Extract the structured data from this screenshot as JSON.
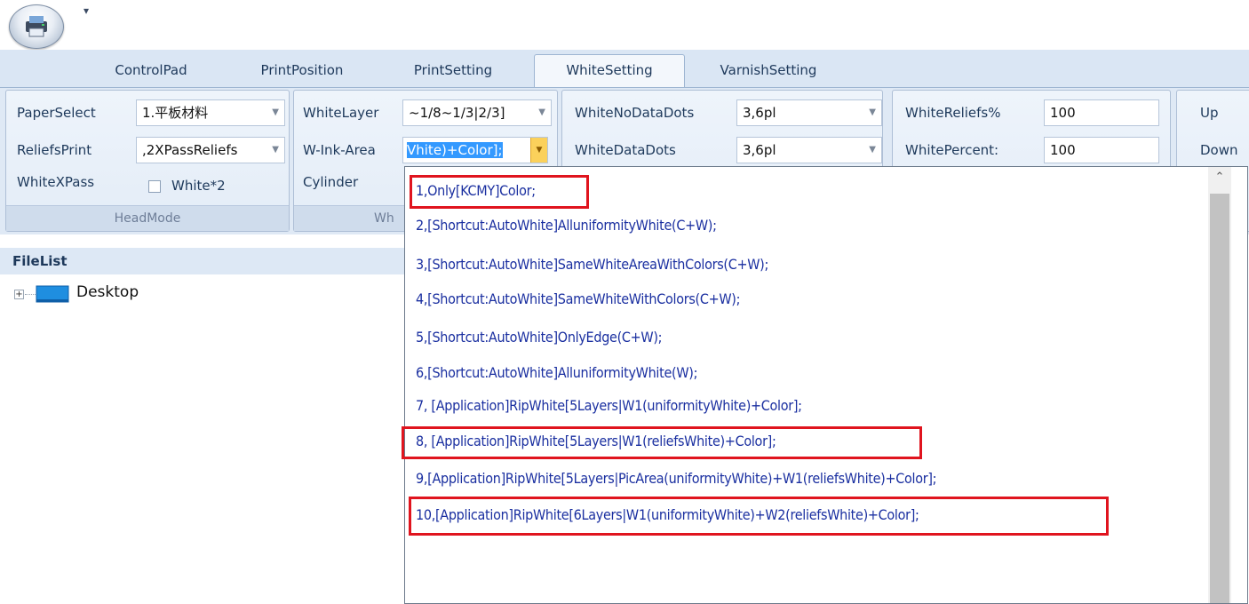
{
  "quick_access": {
    "dropdown_glyph": "▾"
  },
  "tabs": [
    {
      "label": "ControlPad"
    },
    {
      "label": "PrintPosition"
    },
    {
      "label": "PrintSetting"
    },
    {
      "label": "WhiteSetting",
      "active": true
    },
    {
      "label": "VarnishSetting"
    }
  ],
  "head_mode_group": {
    "caption": "HeadMode",
    "paper_select_label": "PaperSelect",
    "paper_select_value": "1.平板材料",
    "reliefs_print_label": "ReliefsPrint",
    "reliefs_print_value": ",2XPassReliefs",
    "white_xpass_label": "WhiteXPass",
    "white_x2_label": "White*2",
    "white_x2_checked": false
  },
  "white_group": {
    "caption_partial": "Wh",
    "white_layer_label": "WhiteLayer",
    "white_layer_value": "~1/8~1/3|2/3]",
    "w_ink_area_label": "W-Ink-Area",
    "w_ink_area_value": "Vhite)+Color];",
    "cylinder_label": "Cylinder"
  },
  "dots_group": {
    "white_no_data_dots_label": "WhiteNoDataDots",
    "white_no_data_dots_value": "3,6pl",
    "white_data_dots_label": "WhiteDataDots",
    "white_data_dots_value": "3,6pl"
  },
  "percent_group": {
    "white_reliefs_label": "WhiteReliefs%",
    "white_reliefs_value": "100",
    "white_percent_label": "WhitePercent:",
    "white_percent_value": "100"
  },
  "updown_group": {
    "up_label": "Up",
    "down_label": "Down"
  },
  "filelist": {
    "header": "FileList",
    "expander": "+",
    "root_item": "Desktop"
  },
  "dropdown": {
    "options": [
      "1,Only[KCMY]Color;",
      "2,[Shortcut:AutoWhite]AlluniformityWhite(C+W);",
      "3,[Shortcut:AutoWhite]SameWhiteAreaWithColors(C+W);",
      "4,[Shortcut:AutoWhite]SameWhiteWithColors(C+W);",
      "5,[Shortcut:AutoWhite]OnlyEdge(C+W);",
      "6,[Shortcut:AutoWhite]AlluniformityWhite(W);",
      "7, [Application]RipWhite[5Layers|W1(uniformityWhite)+Color];",
      "8, [Application]RipWhite[5Layers|W1(reliefsWhite)+Color];",
      "9,[Application]RipWhite[5Layers|PicArea(uniformityWhite)+W1(reliefsWhite)+Color];",
      "10,[Application]RipWhite[6Layers|W1(uniformityWhite)+W2(reliefsWhite)+Color];"
    ],
    "highlighted_options": [
      1,
      8,
      10
    ],
    "highlight_color": "#e0141e",
    "scroll_up_glyph": "⌃"
  },
  "colors": {
    "ribbon_bg": "#dfe9f5",
    "tab_bar": "#dae6f4",
    "option_text": "#1a2fa0",
    "selection": "#3399ff"
  }
}
